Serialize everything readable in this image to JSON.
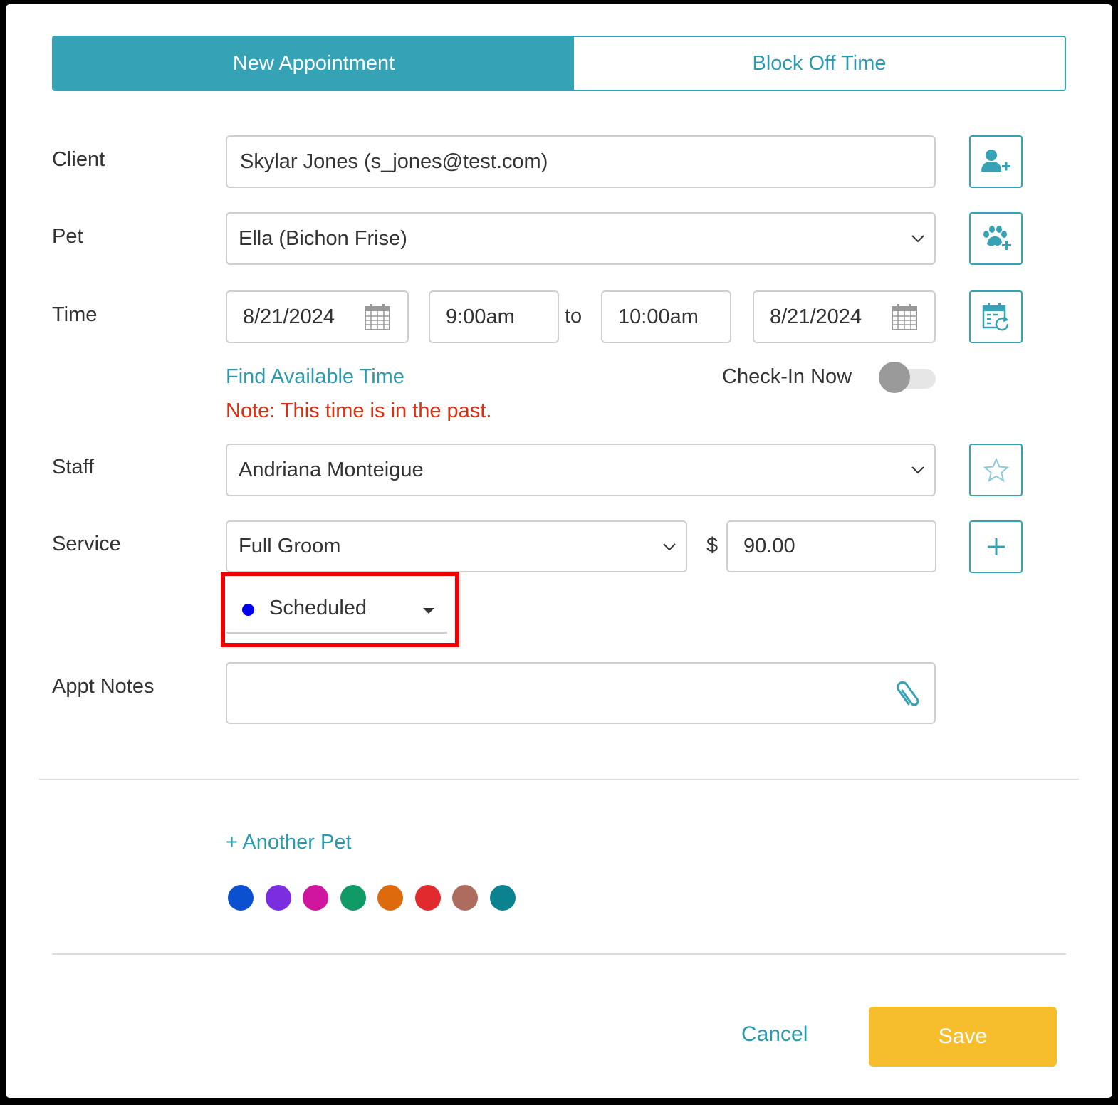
{
  "tabs": {
    "new_appointment": "New Appointment",
    "block_off_time": "Block Off Time"
  },
  "form": {
    "client": {
      "label": "Client",
      "value": "Skylar Jones (s_jones@test.com)"
    },
    "pet": {
      "label": "Pet",
      "value": "Ella (Bichon Frise)"
    },
    "time": {
      "label": "Time",
      "start_date": "8/21/2024",
      "start_time": "9:00am",
      "separator": "to",
      "end_time": "10:00am",
      "end_date": "8/21/2024"
    },
    "find_time_link": "Find Available Time",
    "checkin_label": "Check-In Now",
    "checkin_on": false,
    "past_note": "Note: This time is in the past.",
    "staff": {
      "label": "Staff",
      "value": "Andriana Monteigue"
    },
    "service": {
      "label": "Service",
      "value": "Full Groom",
      "currency": "$",
      "price": "90.00"
    },
    "status": {
      "value": "Scheduled",
      "dot_color": "#0000ee"
    },
    "notes": {
      "label": "Appt Notes",
      "value": ""
    }
  },
  "another_pet_link": "+ Another Pet",
  "color_swatches": [
    "#0a50cf",
    "#7a2ee0",
    "#d0159e",
    "#0f9a66",
    "#dd6a0c",
    "#e02a2d",
    "#ad6c5e",
    "#0a8290"
  ],
  "footer": {
    "cancel": "Cancel",
    "save": "Save"
  },
  "accent_color": "#36a2b5",
  "icons": [
    "add-client-icon",
    "add-pet-icon",
    "recurring-calendar-icon",
    "star-icon",
    "plus-icon",
    "paperclip-icon",
    "calendar-icon",
    "chevron-down-icon"
  ]
}
